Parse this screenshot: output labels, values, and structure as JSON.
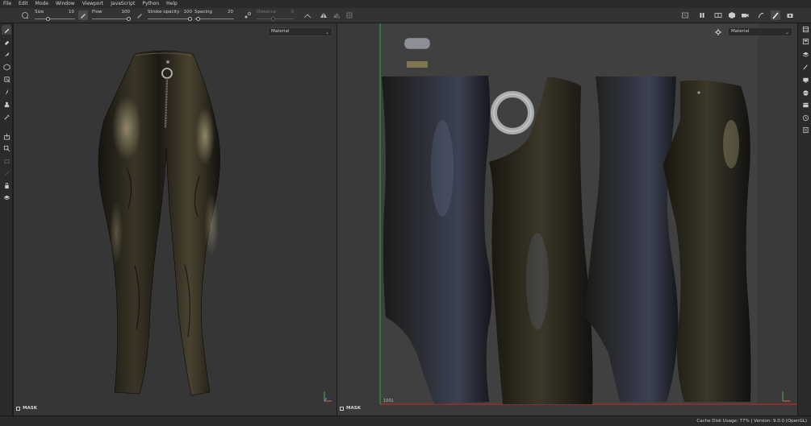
{
  "menu": [
    "File",
    "Edit",
    "Mode",
    "Window",
    "Viewport",
    "JavaScript",
    "Python",
    "Help"
  ],
  "toolbar": {
    "size": {
      "label": "Size",
      "value": "10"
    },
    "flow": {
      "label": "Flow",
      "value": "100"
    },
    "stroke_opacity": {
      "label": "Stroke opacity",
      "value": "100"
    },
    "spacing": {
      "label": "Spacing",
      "value": "20"
    },
    "distance": {
      "label": "Distance",
      "value": "0"
    }
  },
  "viewport3d": {
    "dropdown": "Material",
    "mask_label": "MASK"
  },
  "viewport2d": {
    "dropdown": "Material",
    "mask_label": "MASK",
    "udim_label": "1001"
  },
  "status": {
    "text": "Cache Disk Usage:   77% | Version: 9.0.0 (OpenGL)"
  },
  "icons": {
    "left_tools": [
      "paint-brush-icon",
      "eraser-icon",
      "projection-icon",
      "polygon-fill-icon",
      "geometry-icon",
      "smudge-icon",
      "clone-icon",
      "color-picker-icon",
      "bake-icon",
      "transform-icon",
      "measure-icon",
      "annotate-icon",
      "lock-icon",
      "material-ball-icon"
    ],
    "right_tools": [
      "texture-set-icon",
      "layers-icon",
      "properties-icon",
      "brush-settings-icon",
      "display-icon",
      "environment-icon",
      "shelf-icon",
      "history-icon",
      "log-icon"
    ]
  },
  "colors": {
    "menubar": "#2b2b2b",
    "toolbar": "#333333",
    "viewport3d_bg": "#363636",
    "viewport2d_bg": "#3a3a3a",
    "uv_border_green": "#2e9b3d",
    "uv_border_red": "#b02a2a"
  }
}
